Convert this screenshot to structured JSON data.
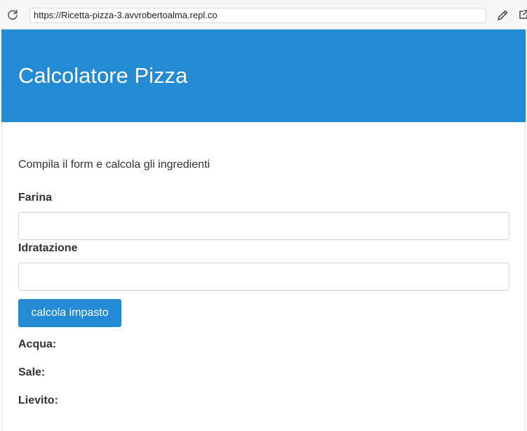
{
  "browser": {
    "url": "https://Ricetta-pizza-3.avvrobertoalma.repl.co",
    "reload_icon": "reload-icon",
    "edit_icon": "pencil-icon",
    "open_icon": "open-external-icon"
  },
  "header": {
    "title": "Calcolatore Pizza",
    "bg_color": "#238ad3"
  },
  "main": {
    "intro": "Compila il form e calcola gli ingredienti",
    "fields": [
      {
        "label": "Farina",
        "value": "",
        "placeholder": ""
      },
      {
        "label": "Idratazione",
        "value": "",
        "placeholder": ""
      }
    ],
    "button_label": "calcola impasto",
    "results": [
      {
        "label": "Acqua:"
      },
      {
        "label": "Sale:"
      },
      {
        "label": "Lievito:"
      }
    ]
  }
}
